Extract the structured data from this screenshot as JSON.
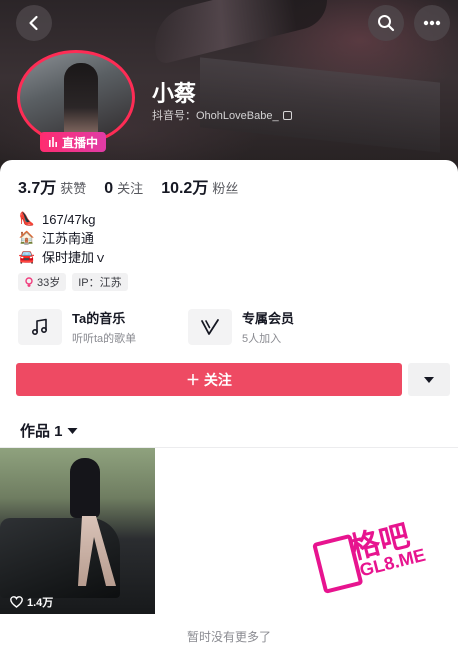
{
  "header": {
    "back_icon": "back-arrow-icon",
    "search_icon": "search-icon",
    "more_icon": "more-dots-icon"
  },
  "profile": {
    "nickname": "小蔡",
    "douyin_id_label": "抖音号：OhohLoveBabe_",
    "live_badge": "直播中"
  },
  "stats": [
    {
      "value": "3.7万",
      "label": "获赞"
    },
    {
      "value": "0",
      "label": "关注"
    },
    {
      "value": "10.2万",
      "label": "粉丝"
    }
  ],
  "bio": [
    {
      "emoji": "👠",
      "text": "167/47kg"
    },
    {
      "emoji": "🏠",
      "text": "江苏南通"
    },
    {
      "emoji": "🚘",
      "text": "保时捷加ｖ"
    }
  ],
  "tags": {
    "age": "33岁",
    "ip": "IP：江苏"
  },
  "features": {
    "music": {
      "title": "Ta的音乐",
      "subtitle": "听听ta的歌单",
      "icon": "music-note-icon"
    },
    "member": {
      "title": "专属会员",
      "subtitle": "5人加入",
      "icon": "member-v-icon"
    }
  },
  "actions": {
    "follow_label": "＋ 关注",
    "dropdown_icon": "triangle-down-icon"
  },
  "works": {
    "tab_label": "作品 1",
    "items": [
      {
        "likes": "1.4万"
      }
    ],
    "end_text": "暂时没有更多了"
  },
  "watermark": {
    "big": "格吧",
    "small": "GL8.ME"
  },
  "colors": {
    "accent": "#ee4a63",
    "live": "#fe2c55",
    "watermark": "#e7148f"
  }
}
